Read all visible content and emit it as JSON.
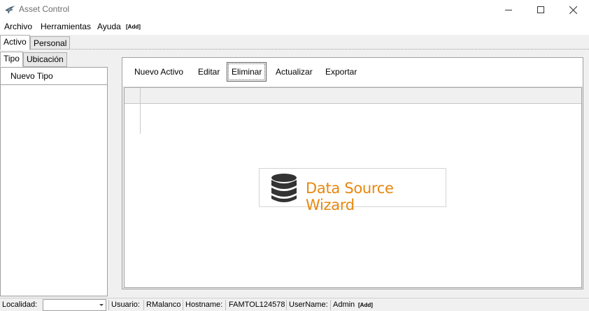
{
  "window": {
    "title": "Asset Control"
  },
  "menu": {
    "items": [
      "Archivo",
      "Herramientas",
      "Ayuda"
    ],
    "add_label": "[Add]"
  },
  "top_tabs": [
    "Activo",
    "Personal"
  ],
  "left_tabs": [
    "Tipo",
    "Ubicación"
  ],
  "left_panel": {
    "new_label": "Nuevo Tipo"
  },
  "toolbar": {
    "buttons": [
      "Nuevo Activo",
      "Editar",
      "Eliminar",
      "Actualizar",
      "Exportar"
    ]
  },
  "wizard": {
    "label": "Data Source Wizard"
  },
  "status": {
    "localidad_label": "Localidad:",
    "localidad_value": "",
    "usuario_label": "Usuario:",
    "usuario_value": "RMalanco",
    "hostname_label": "Hostname:",
    "hostname_value": "FAMTOL124578",
    "username_label": "UserName:",
    "username_value": "Admin",
    "add_label": "[Add]"
  },
  "colors": {
    "wizard_text": "#e8870e",
    "wizard_icon": "#333333"
  },
  "icons": {
    "app": "app-bird-icon",
    "minimize": "minimize-icon",
    "maximize": "maximize-icon",
    "close": "close-icon",
    "database": "database-icon",
    "dropdown": "chevron-down-icon"
  }
}
